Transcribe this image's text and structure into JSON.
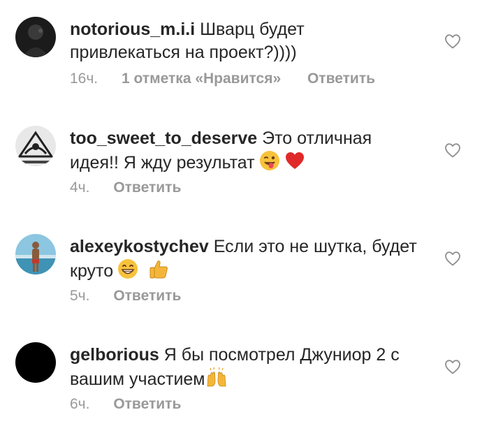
{
  "comments": [
    {
      "username": "notorious_m.i.i",
      "text": "Шварц будет привлекаться на проект?))))",
      "time": "16ч.",
      "likes": "1 отметка «Нравится»",
      "reply": "Ответить",
      "emojis": []
    },
    {
      "username": "too_sweet_to_deserve",
      "text": "Это отличная идея!! Я жду результат",
      "time": "4ч.",
      "likes": "",
      "reply": "Ответить",
      "emojis": [
        "winking-face-tongue-emoji",
        "red-heart-emoji"
      ]
    },
    {
      "username": "alexeykostychev",
      "text": "Если это не шутка, будет круто",
      "time": "5ч.",
      "likes": "",
      "reply": "Ответить",
      "emojis": [
        "grinning-face-emoji",
        "thumbs-up-emoji"
      ]
    },
    {
      "username": "gelborious",
      "text": "Я бы посмотрел Джуниор 2 с вашим участием",
      "time": "6ч.",
      "likes": "",
      "reply": "Ответить",
      "emojis": [
        "raising-hands-emoji"
      ]
    }
  ],
  "colors": {
    "username": "#262626",
    "text": "#262626",
    "meta": "#999999",
    "heart_outline": "#8e8e8e"
  }
}
